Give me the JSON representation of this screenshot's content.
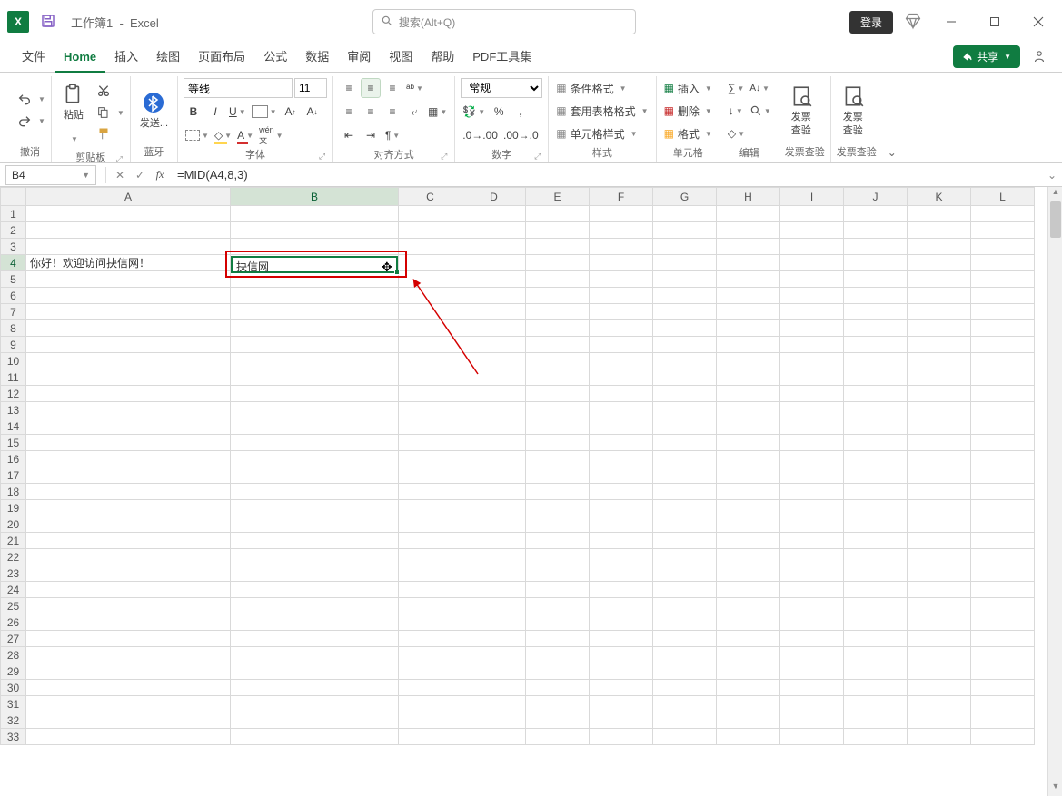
{
  "title": {
    "doc": "工作簿1",
    "app": "Excel"
  },
  "search_placeholder": "搜索(Alt+Q)",
  "login_label": "登录",
  "tabs": [
    "文件",
    "Home",
    "插入",
    "绘图",
    "页面布局",
    "公式",
    "数据",
    "审阅",
    "视图",
    "帮助",
    "PDF工具集"
  ],
  "active_tab": "Home",
  "share_label": "共享",
  "ribbon": {
    "undo_group": "撤消",
    "clipboard_group": "剪贴板",
    "paste_label": "粘贴",
    "bluetooth_group": "蓝牙",
    "send_label": "发送...",
    "font_group": "字体",
    "font_name": "等线",
    "font_size": "11",
    "align_group": "对齐方式",
    "number_group": "数字",
    "number_format": "常规",
    "styles_group": "样式",
    "cond_format": "条件格式",
    "table_format": "套用表格格式",
    "cell_styles": "单元格样式",
    "cells_group": "单元格",
    "insert": "插入",
    "delete": "删除",
    "format": "格式",
    "editing_group": "编辑",
    "invoice1_group": "发票查验",
    "invoice1_label": "发票\n查验",
    "invoice2_group": "发票查验",
    "invoice2_label": "发票\n查验"
  },
  "name_box": "B4",
  "formula": "=MID(A4,8,3)",
  "columns": [
    "A",
    "B",
    "C",
    "D",
    "E",
    "F",
    "G",
    "H",
    "I",
    "J",
    "K",
    "L"
  ],
  "rows": 33,
  "cells": {
    "A4": "你好！欢迎访问抉信网！",
    "B4": "抉信网"
  }
}
